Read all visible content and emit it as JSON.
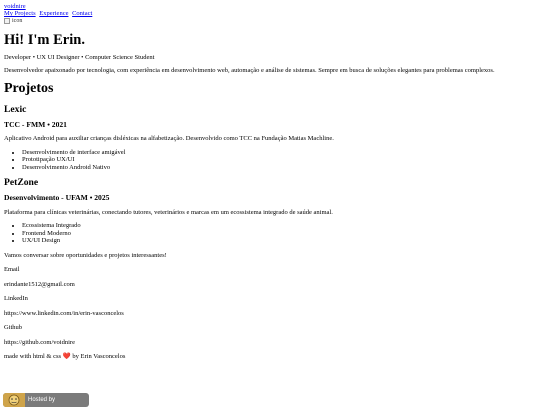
{
  "nav": {
    "brand": "voidnire",
    "links": [
      "My Projects",
      "Experience",
      "Contact"
    ]
  },
  "hero": {
    "img_alt": "icon",
    "title": "Hi! I'm Erin.",
    "tagline": "Developer • UX UI Designer • Computer Science Student",
    "bio": "Desenvolvedor apaixonado por tecnologia, com experiência em desenvolvimento web, automação e análise de sistemas. Sempre em busca de soluções elegantes para problemas complexos."
  },
  "projects": {
    "heading": "Projetos",
    "items": [
      {
        "name": "Lexic",
        "subtitle": "TCC - FMM • 2021",
        "description": "Aplicativo Android para auxiliar crianças disléxicas na alfabetização. Desenvolvido como TCC na Fundação Matias Machline.",
        "bullets": [
          "Desenvolvimento de interface amigável",
          "Prototipação UX/UI",
          "Desenvolvimento Android Nativo"
        ]
      },
      {
        "name": "PetZone",
        "subtitle": "Desenvolvimento - UFAM • 2025",
        "description": "Plataforma para clínicas veterinárias, conectando tutores, veterinários e marcas em um ecossistema integrado de saúde animal.",
        "bullets": [
          "Ecossistema Integrado",
          "Frontend Moderno",
          "UX/UI Design"
        ]
      }
    ]
  },
  "contact": {
    "intro": "Vamos conversar sobre oportunidades e projetos interessantes!",
    "email_label": "Email",
    "email_value": "erindante1512@gmail.com",
    "linkedin_label": "LinkedIn",
    "linkedin_value": "https://www.linkedin.com/in/erin-vasconcelos",
    "github_label": "Github",
    "github_value": "https://github.com/voidnire"
  },
  "footer": {
    "prefix": "made with html & css",
    "heart": "❤️",
    "suffix": "by Erin Vasconcelos"
  },
  "badge": {
    "label": "Hosted by"
  }
}
